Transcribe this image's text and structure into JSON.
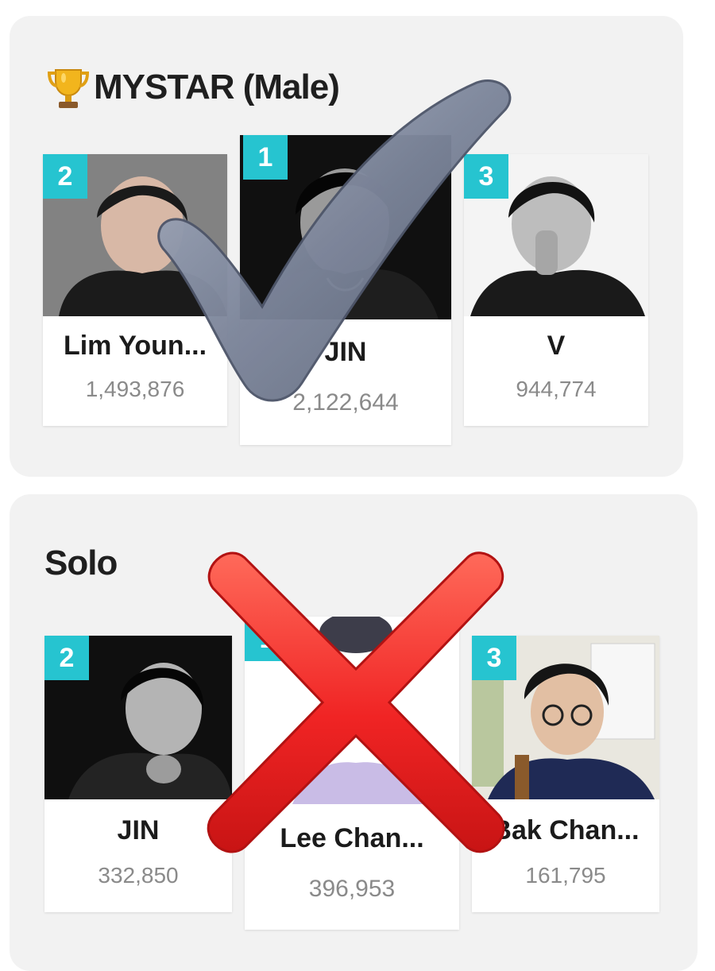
{
  "mystar": {
    "title": "MYSTAR (Male)",
    "trophy_icon": "trophy-icon",
    "cards": [
      {
        "rank": "2",
        "name": "Lim Youn...",
        "votes": "1,493,876"
      },
      {
        "rank": "1",
        "name": "JIN",
        "votes": "2,122,644"
      },
      {
        "rank": "3",
        "name": "V",
        "votes": "944,774"
      }
    ]
  },
  "solo": {
    "title": "Solo",
    "cards": [
      {
        "rank": "2",
        "name": "JIN",
        "votes": "332,850"
      },
      {
        "rank": "1",
        "name": "Lee Chan...",
        "votes": "396,953"
      },
      {
        "rank": "3",
        "name": "Bak Chan...",
        "votes": "161,795"
      }
    ]
  },
  "overlays": {
    "check_icon": "check-mark-icon",
    "cross_icon": "cross-mark-icon"
  },
  "colors": {
    "rank_badge": "#26c4d0",
    "panel_bg": "#f2f2f2"
  }
}
